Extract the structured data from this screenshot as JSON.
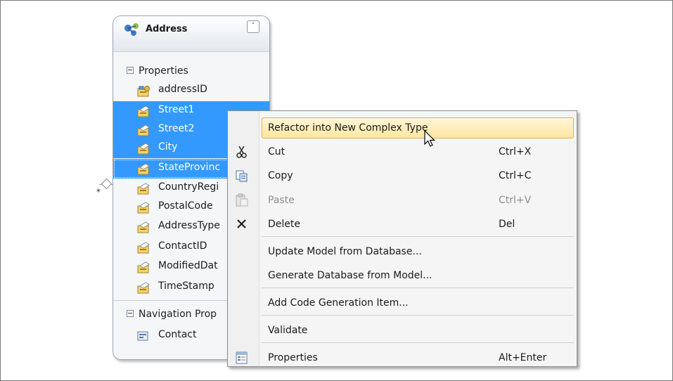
{
  "entity": {
    "title": "Address",
    "collapse_glyph": "˄",
    "sections": {
      "properties_label": "Properties",
      "navigation_label": "Navigation Prop"
    },
    "properties": [
      {
        "name": "addressID",
        "icon": "key-property-icon",
        "selected": false
      },
      {
        "name": "Street1",
        "icon": "property-icon",
        "selected": true
      },
      {
        "name": "Street2",
        "icon": "property-icon",
        "selected": true
      },
      {
        "name": "City",
        "icon": "property-icon",
        "selected": true
      },
      {
        "name": "StateProvinc",
        "icon": "property-icon",
        "selected": true
      },
      {
        "name": "CountryRegi",
        "icon": "property-icon",
        "selected": false
      },
      {
        "name": "PostalCode",
        "icon": "property-icon",
        "selected": false
      },
      {
        "name": "AddressType",
        "icon": "property-icon",
        "selected": false
      },
      {
        "name": "ContactID",
        "icon": "property-icon",
        "selected": false
      },
      {
        "name": "ModifiedDat",
        "icon": "property-icon",
        "selected": false
      },
      {
        "name": "TimeStamp",
        "icon": "property-icon",
        "selected": false
      }
    ],
    "navigation": [
      {
        "name": "Contact",
        "icon": "navigation-property-icon"
      }
    ]
  },
  "connector": {
    "multiplicity": "*"
  },
  "context_menu": {
    "items": [
      {
        "label": "Refactor into New Complex Type",
        "shortcut": "",
        "icon": "",
        "highlighted": true,
        "disabled": false
      },
      {
        "label": "Cut",
        "shortcut": "Ctrl+X",
        "icon": "scissors-icon",
        "highlighted": false,
        "disabled": false
      },
      {
        "label": "Copy",
        "shortcut": "Ctrl+C",
        "icon": "copy-icon",
        "highlighted": false,
        "disabled": false
      },
      {
        "label": "Paste",
        "shortcut": "Ctrl+V",
        "icon": "paste-icon",
        "highlighted": false,
        "disabled": true
      },
      {
        "label": "Delete",
        "shortcut": "Del",
        "icon": "delete-icon",
        "highlighted": false,
        "disabled": false
      },
      {
        "label": "Update Model from Database...",
        "shortcut": "",
        "icon": "",
        "highlighted": false,
        "disabled": false
      },
      {
        "label": "Generate Database from Model...",
        "shortcut": "",
        "icon": "",
        "highlighted": false,
        "disabled": false
      },
      {
        "label": "Add Code Generation Item...",
        "shortcut": "",
        "icon": "",
        "highlighted": false,
        "disabled": false
      },
      {
        "label": "Validate",
        "shortcut": "",
        "icon": "",
        "highlighted": false,
        "disabled": false
      },
      {
        "label": "Properties",
        "shortcut": "Alt+Enter",
        "icon": "properties-icon",
        "highlighted": false,
        "disabled": false
      }
    ]
  },
  "colors": {
    "selection": "#3399ff",
    "menu_highlight": "#ffe6a0",
    "menu_background": "#f5f5f5",
    "entity_background": "#f4f6f8"
  }
}
